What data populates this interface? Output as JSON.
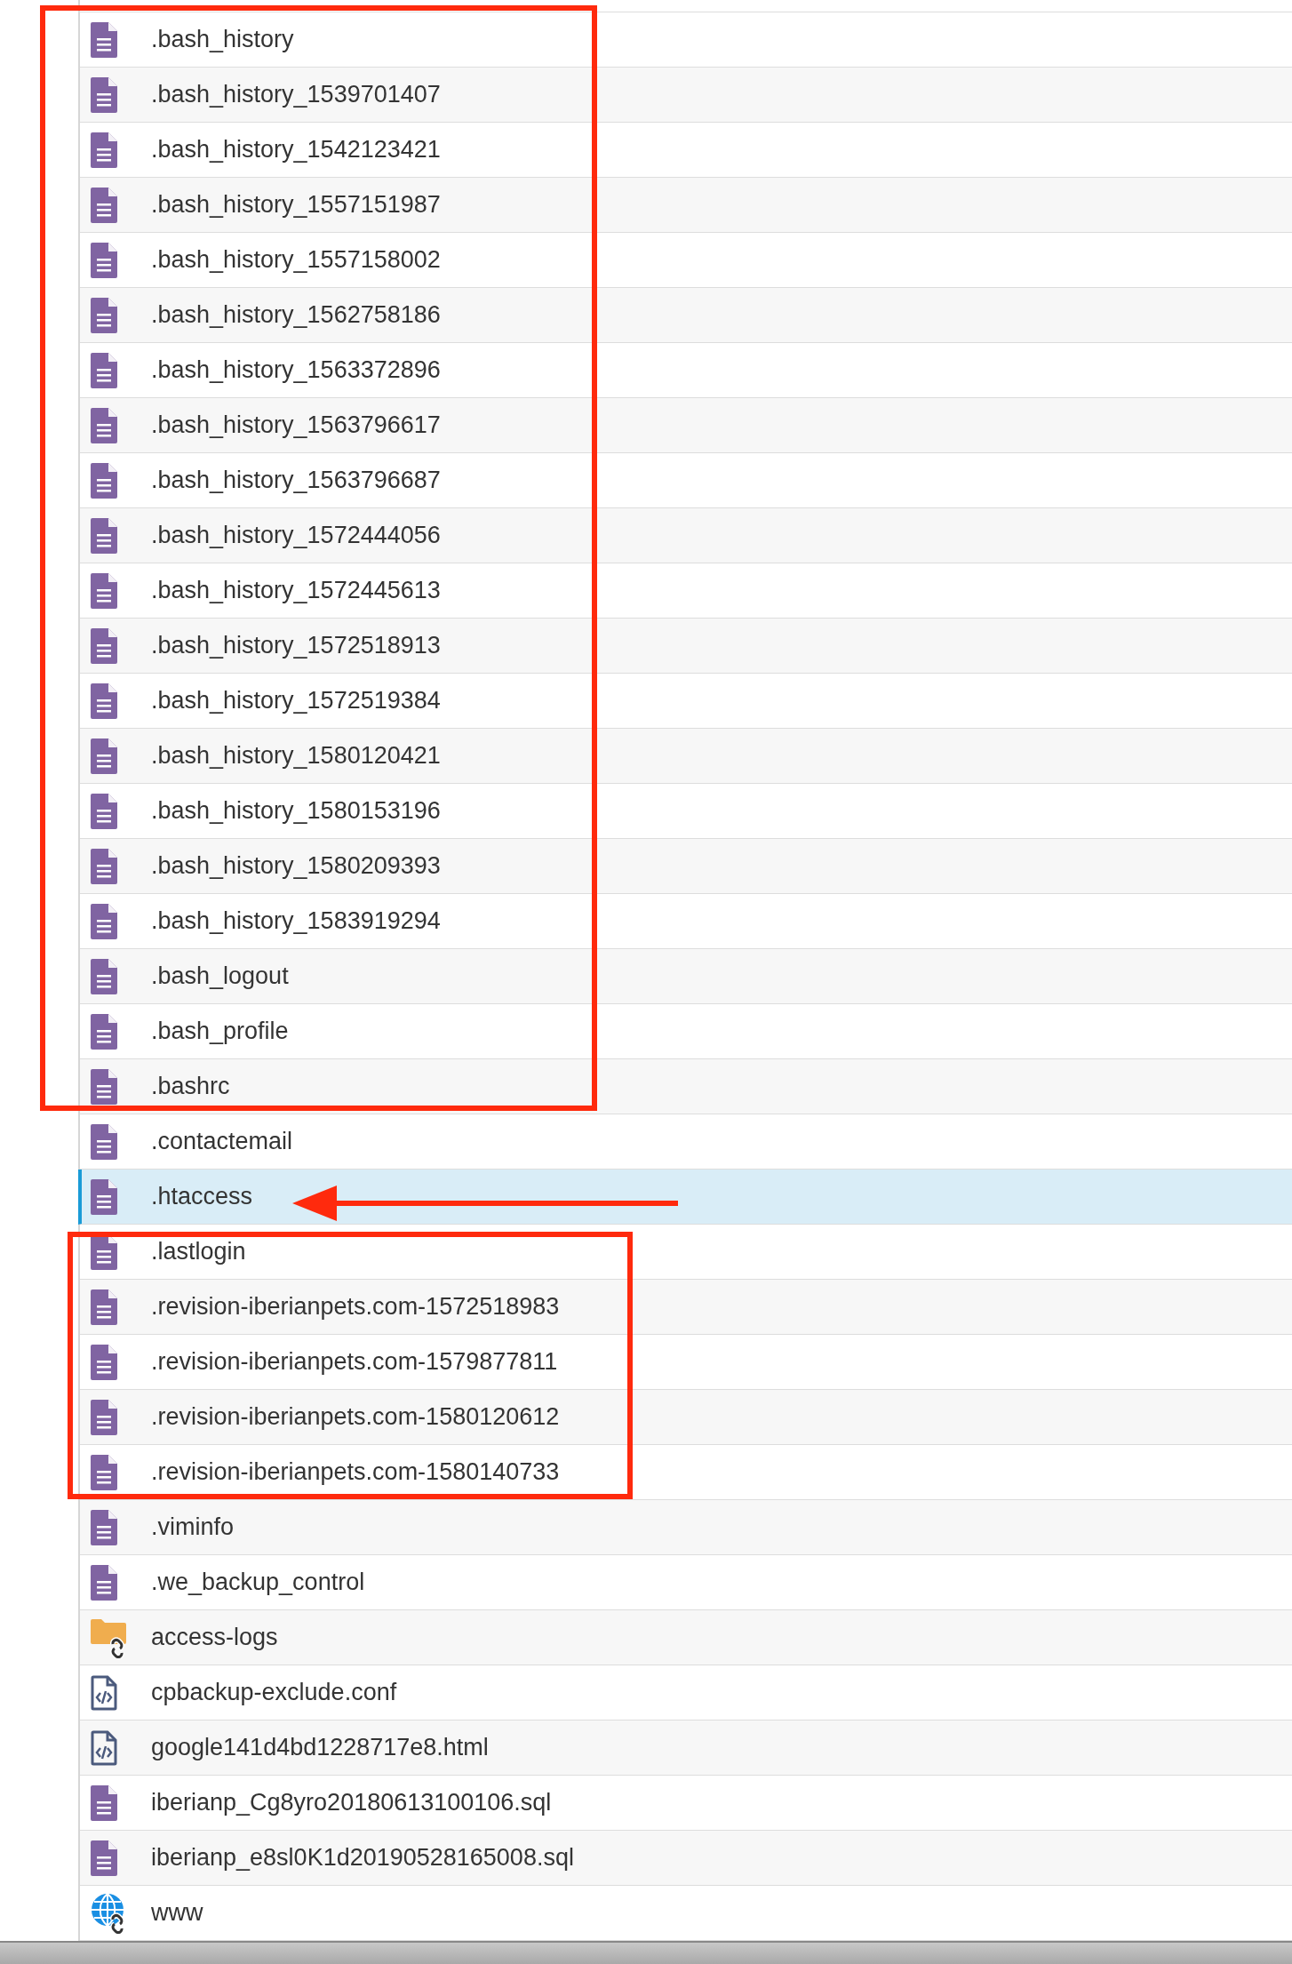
{
  "files": [
    {
      "name": ".bash_history",
      "kind": "text",
      "selected": false
    },
    {
      "name": ".bash_history_1539701407",
      "kind": "text",
      "selected": false
    },
    {
      "name": ".bash_history_1542123421",
      "kind": "text",
      "selected": false
    },
    {
      "name": ".bash_history_1557151987",
      "kind": "text",
      "selected": false
    },
    {
      "name": ".bash_history_1557158002",
      "kind": "text",
      "selected": false
    },
    {
      "name": ".bash_history_1562758186",
      "kind": "text",
      "selected": false
    },
    {
      "name": ".bash_history_1563372896",
      "kind": "text",
      "selected": false
    },
    {
      "name": ".bash_history_1563796617",
      "kind": "text",
      "selected": false
    },
    {
      "name": ".bash_history_1563796687",
      "kind": "text",
      "selected": false
    },
    {
      "name": ".bash_history_1572444056",
      "kind": "text",
      "selected": false
    },
    {
      "name": ".bash_history_1572445613",
      "kind": "text",
      "selected": false
    },
    {
      "name": ".bash_history_1572518913",
      "kind": "text",
      "selected": false
    },
    {
      "name": ".bash_history_1572519384",
      "kind": "text",
      "selected": false
    },
    {
      "name": ".bash_history_1580120421",
      "kind": "text",
      "selected": false
    },
    {
      "name": ".bash_history_1580153196",
      "kind": "text",
      "selected": false
    },
    {
      "name": ".bash_history_1580209393",
      "kind": "text",
      "selected": false
    },
    {
      "name": ".bash_history_1583919294",
      "kind": "text",
      "selected": false
    },
    {
      "name": ".bash_logout",
      "kind": "text",
      "selected": false
    },
    {
      "name": ".bash_profile",
      "kind": "text",
      "selected": false
    },
    {
      "name": ".bashrc",
      "kind": "text",
      "selected": false
    },
    {
      "name": ".contactemail",
      "kind": "text",
      "selected": false
    },
    {
      "name": ".htaccess",
      "kind": "text",
      "selected": true
    },
    {
      "name": ".lastlogin",
      "kind": "text",
      "selected": false
    },
    {
      "name": ".revision-iberianpets.com-1572518983",
      "kind": "text",
      "selected": false
    },
    {
      "name": ".revision-iberianpets.com-1579877811",
      "kind": "text",
      "selected": false
    },
    {
      "name": ".revision-iberianpets.com-1580120612",
      "kind": "text",
      "selected": false
    },
    {
      "name": ".revision-iberianpets.com-1580140733",
      "kind": "text",
      "selected": false
    },
    {
      "name": ".viminfo",
      "kind": "text",
      "selected": false
    },
    {
      "name": ".we_backup_control",
      "kind": "text",
      "selected": false
    },
    {
      "name": "access-logs",
      "kind": "folder_link",
      "selected": false
    },
    {
      "name": "cpbackup-exclude.conf",
      "kind": "code",
      "selected": false
    },
    {
      "name": "google141d4bd1228717e8.html",
      "kind": "code",
      "selected": false
    },
    {
      "name": "iberianp_Cg8yro20180613100106.sql",
      "kind": "text",
      "selected": false
    },
    {
      "name": "iberianp_e8sl0K1d20190528165008.sql",
      "kind": "text",
      "selected": false
    },
    {
      "name": "www",
      "kind": "globe_link",
      "selected": false
    }
  ]
}
